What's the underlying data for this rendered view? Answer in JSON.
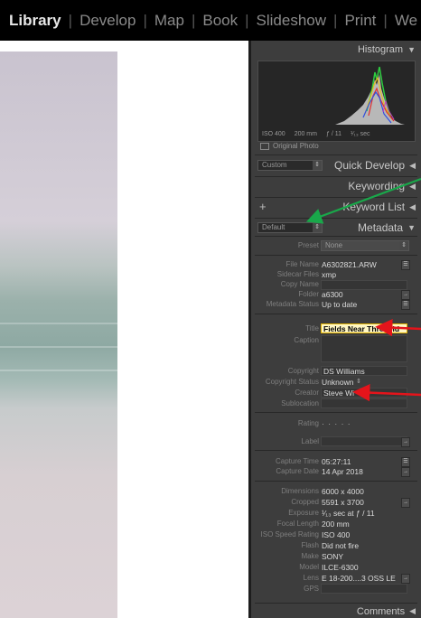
{
  "modules": [
    "Library",
    "Develop",
    "Map",
    "Book",
    "Slideshow",
    "Print",
    "We"
  ],
  "active_module": "Library",
  "histogram": {
    "title": "Histogram",
    "iso": "ISO 400",
    "focal": "200 mm",
    "aperture": "ƒ / 11",
    "shutter": "¹⁄₁₃ sec",
    "original_photo": "Original Photo"
  },
  "quick_develop": {
    "preset": "Custom",
    "title": "Quick Develop"
  },
  "keywording": {
    "title": "Keywording"
  },
  "keyword_list": {
    "title": "Keyword List",
    "plus": "+"
  },
  "metadata": {
    "preset_selector": "Default",
    "title": "Metadata",
    "preset_label": "Preset",
    "preset_value": "None",
    "rows": [
      {
        "label": "File Name",
        "value": "A6302821.ARW"
      },
      {
        "label": "Sidecar Files",
        "value": "xmp"
      },
      {
        "label": "Copy Name",
        "value": ""
      },
      {
        "label": "Folder",
        "value": "a6300"
      },
      {
        "label": "Metadata Status",
        "value": "Up to date"
      }
    ],
    "title_label": "Title",
    "title_value": "Fields Near Threfield",
    "caption_label": "Caption",
    "copyright_label": "Copyright",
    "copyright_value": "DS Williams",
    "copyright_status_label": "Copyright Status",
    "copyright_status_value": "Unknown",
    "creator_label": "Creator",
    "creator_value": "Steve Wi",
    "sublocation_label": "Sublocation",
    "rating_label": "Rating",
    "rating_value": "· · · · ·",
    "label_label": "Label",
    "capture": [
      {
        "label": "Capture Time",
        "value": "05:27:11"
      },
      {
        "label": "Capture Date",
        "value": "14 Apr 2018"
      }
    ],
    "exif": [
      {
        "label": "Dimensions",
        "value": "6000 x 4000"
      },
      {
        "label": "Cropped",
        "value": "5591 x 3700"
      },
      {
        "label": "Exposure",
        "value": "¹⁄₁₃ sec at ƒ / 11"
      },
      {
        "label": "Focal Length",
        "value": "200 mm"
      },
      {
        "label": "ISO Speed Rating",
        "value": "ISO 400"
      },
      {
        "label": "Flash",
        "value": "Did not fire"
      },
      {
        "label": "Make",
        "value": "SONY"
      },
      {
        "label": "Model",
        "value": "ILCE-6300"
      },
      {
        "label": "Lens",
        "value": "E 18-200....3 OSS LE"
      },
      {
        "label": "GPS",
        "value": ""
      }
    ]
  },
  "comments": {
    "title": "Comments"
  },
  "colors": {
    "panel_bg": "#3d3d3d",
    "title_highlight": "#fff7c4",
    "arrow_green": "#19a84a",
    "arrow_red": "#e4141b"
  }
}
